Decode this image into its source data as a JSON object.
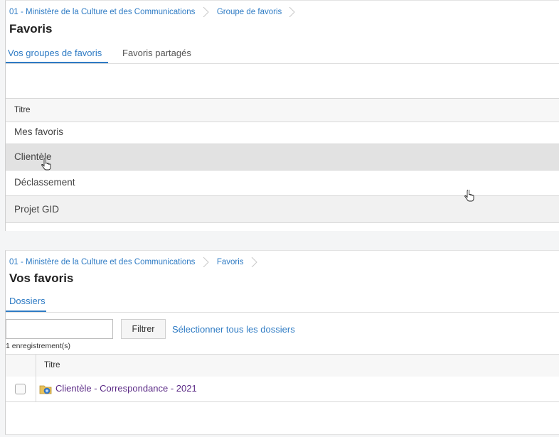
{
  "top_panel": {
    "breadcrumb": [
      "01 - Ministère de la Culture et des Communications",
      "Groupe de favoris"
    ],
    "title": "Favoris",
    "tabs": [
      {
        "label": "Vos groupes de favoris",
        "active": true
      },
      {
        "label": "Favoris partagés",
        "active": false
      }
    ],
    "table": {
      "header": "Titre",
      "rows": [
        "Mes favoris",
        "Clientèle",
        "Déclassement",
        "Projet GID"
      ]
    }
  },
  "bottom_panel": {
    "breadcrumb": [
      "01 - Ministère de la Culture et des Communications",
      "Favoris"
    ],
    "title": "Vos favoris",
    "tabs": [
      {
        "label": "Dossiers",
        "active": true
      }
    ],
    "filter": {
      "value": "",
      "placeholder": "",
      "button_label": "Filtrer"
    },
    "select_all_label": "Sélectionner tous les dossiers",
    "record_count": "1 enregistrement(s)",
    "grid": {
      "header": "Titre",
      "rows": [
        {
          "label": "Clientèle - Correspondance - 2021",
          "icon": "folder-icon",
          "checked": false
        }
      ]
    }
  },
  "colors": {
    "link": "#2e7bc4",
    "visited_link": "#5b2a86",
    "tab_accent": "#2e7bc4",
    "row_hover": "#e2e2e2"
  }
}
